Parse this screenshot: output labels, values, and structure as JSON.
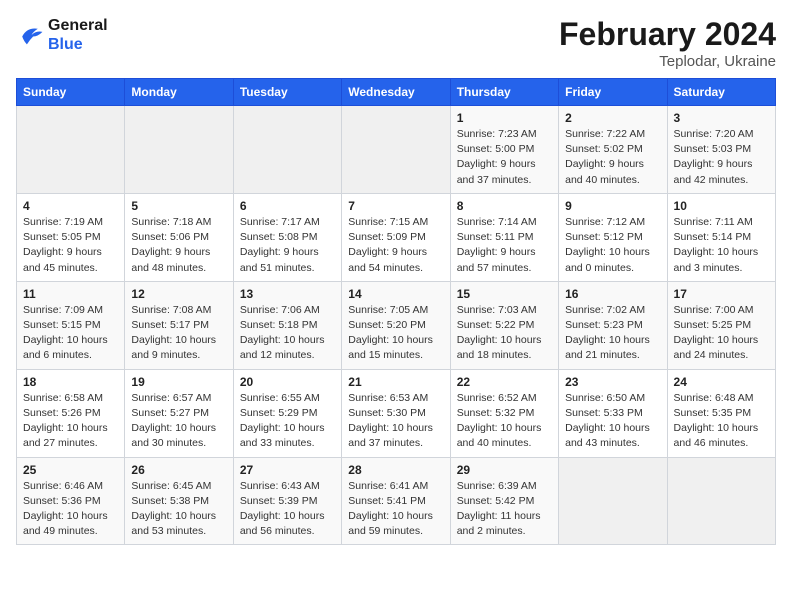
{
  "header": {
    "logo_line1": "General",
    "logo_line2": "Blue",
    "month": "February 2024",
    "location": "Teplodar, Ukraine"
  },
  "weekdays": [
    "Sunday",
    "Monday",
    "Tuesday",
    "Wednesday",
    "Thursday",
    "Friday",
    "Saturday"
  ],
  "weeks": [
    [
      {
        "day": "",
        "info": ""
      },
      {
        "day": "",
        "info": ""
      },
      {
        "day": "",
        "info": ""
      },
      {
        "day": "",
        "info": ""
      },
      {
        "day": "1",
        "info": "Sunrise: 7:23 AM\nSunset: 5:00 PM\nDaylight: 9 hours\nand 37 minutes."
      },
      {
        "day": "2",
        "info": "Sunrise: 7:22 AM\nSunset: 5:02 PM\nDaylight: 9 hours\nand 40 minutes."
      },
      {
        "day": "3",
        "info": "Sunrise: 7:20 AM\nSunset: 5:03 PM\nDaylight: 9 hours\nand 42 minutes."
      }
    ],
    [
      {
        "day": "4",
        "info": "Sunrise: 7:19 AM\nSunset: 5:05 PM\nDaylight: 9 hours\nand 45 minutes."
      },
      {
        "day": "5",
        "info": "Sunrise: 7:18 AM\nSunset: 5:06 PM\nDaylight: 9 hours\nand 48 minutes."
      },
      {
        "day": "6",
        "info": "Sunrise: 7:17 AM\nSunset: 5:08 PM\nDaylight: 9 hours\nand 51 minutes."
      },
      {
        "day": "7",
        "info": "Sunrise: 7:15 AM\nSunset: 5:09 PM\nDaylight: 9 hours\nand 54 minutes."
      },
      {
        "day": "8",
        "info": "Sunrise: 7:14 AM\nSunset: 5:11 PM\nDaylight: 9 hours\nand 57 minutes."
      },
      {
        "day": "9",
        "info": "Sunrise: 7:12 AM\nSunset: 5:12 PM\nDaylight: 10 hours\nand 0 minutes."
      },
      {
        "day": "10",
        "info": "Sunrise: 7:11 AM\nSunset: 5:14 PM\nDaylight: 10 hours\nand 3 minutes."
      }
    ],
    [
      {
        "day": "11",
        "info": "Sunrise: 7:09 AM\nSunset: 5:15 PM\nDaylight: 10 hours\nand 6 minutes."
      },
      {
        "day": "12",
        "info": "Sunrise: 7:08 AM\nSunset: 5:17 PM\nDaylight: 10 hours\nand 9 minutes."
      },
      {
        "day": "13",
        "info": "Sunrise: 7:06 AM\nSunset: 5:18 PM\nDaylight: 10 hours\nand 12 minutes."
      },
      {
        "day": "14",
        "info": "Sunrise: 7:05 AM\nSunset: 5:20 PM\nDaylight: 10 hours\nand 15 minutes."
      },
      {
        "day": "15",
        "info": "Sunrise: 7:03 AM\nSunset: 5:22 PM\nDaylight: 10 hours\nand 18 minutes."
      },
      {
        "day": "16",
        "info": "Sunrise: 7:02 AM\nSunset: 5:23 PM\nDaylight: 10 hours\nand 21 minutes."
      },
      {
        "day": "17",
        "info": "Sunrise: 7:00 AM\nSunset: 5:25 PM\nDaylight: 10 hours\nand 24 minutes."
      }
    ],
    [
      {
        "day": "18",
        "info": "Sunrise: 6:58 AM\nSunset: 5:26 PM\nDaylight: 10 hours\nand 27 minutes."
      },
      {
        "day": "19",
        "info": "Sunrise: 6:57 AM\nSunset: 5:27 PM\nDaylight: 10 hours\nand 30 minutes."
      },
      {
        "day": "20",
        "info": "Sunrise: 6:55 AM\nSunset: 5:29 PM\nDaylight: 10 hours\nand 33 minutes."
      },
      {
        "day": "21",
        "info": "Sunrise: 6:53 AM\nSunset: 5:30 PM\nDaylight: 10 hours\nand 37 minutes."
      },
      {
        "day": "22",
        "info": "Sunrise: 6:52 AM\nSunset: 5:32 PM\nDaylight: 10 hours\nand 40 minutes."
      },
      {
        "day": "23",
        "info": "Sunrise: 6:50 AM\nSunset: 5:33 PM\nDaylight: 10 hours\nand 43 minutes."
      },
      {
        "day": "24",
        "info": "Sunrise: 6:48 AM\nSunset: 5:35 PM\nDaylight: 10 hours\nand 46 minutes."
      }
    ],
    [
      {
        "day": "25",
        "info": "Sunrise: 6:46 AM\nSunset: 5:36 PM\nDaylight: 10 hours\nand 49 minutes."
      },
      {
        "day": "26",
        "info": "Sunrise: 6:45 AM\nSunset: 5:38 PM\nDaylight: 10 hours\nand 53 minutes."
      },
      {
        "day": "27",
        "info": "Sunrise: 6:43 AM\nSunset: 5:39 PM\nDaylight: 10 hours\nand 56 minutes."
      },
      {
        "day": "28",
        "info": "Sunrise: 6:41 AM\nSunset: 5:41 PM\nDaylight: 10 hours\nand 59 minutes."
      },
      {
        "day": "29",
        "info": "Sunrise: 6:39 AM\nSunset: 5:42 PM\nDaylight: 11 hours\nand 2 minutes."
      },
      {
        "day": "",
        "info": ""
      },
      {
        "day": "",
        "info": ""
      }
    ]
  ]
}
